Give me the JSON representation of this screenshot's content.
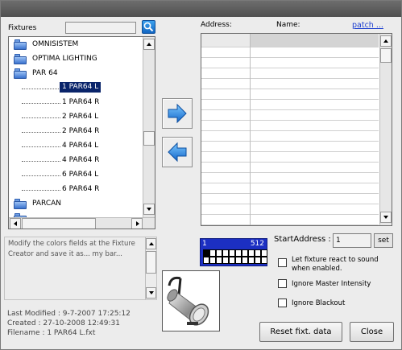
{
  "fixtures": {
    "label": "Fixtures",
    "search_value": "",
    "tree": [
      {
        "type": "folder",
        "label": "OMNISISTEM"
      },
      {
        "type": "folder",
        "label": "OPTIMA LIGHTING"
      },
      {
        "type": "folder",
        "label": "PAR 64"
      },
      {
        "type": "child",
        "label": "1 PAR64 L",
        "selected": true
      },
      {
        "type": "child",
        "label": "1 PAR64 R"
      },
      {
        "type": "child",
        "label": "2 PAR64 L"
      },
      {
        "type": "child",
        "label": "2 PAR64 R"
      },
      {
        "type": "child",
        "label": "4 PAR64 L"
      },
      {
        "type": "child",
        "label": "4 PAR64 R"
      },
      {
        "type": "child",
        "label": "6 PAR64 L"
      },
      {
        "type": "child",
        "label": "6 PAR64 R"
      },
      {
        "type": "folder",
        "label": "PARCAN"
      },
      {
        "type": "folder",
        "label": ""
      }
    ]
  },
  "patch": {
    "address_label": "Address:",
    "name_label": "Name:",
    "patch_link": "patch ..."
  },
  "notes": {
    "text": "Modify the colors fields at the Fixture Creator and save it as... my bar..."
  },
  "file_info": {
    "last_modified": "Last Modified : 9-7-2007 17:25:12",
    "created": "Created : 27-10-2008 12:49:31",
    "filename": "Filename : 1 PAR64 L.fxt"
  },
  "dmx": {
    "start": "1",
    "end": "512",
    "filled_channels": 1
  },
  "start_address": {
    "label": "StartAddress :",
    "value": "1",
    "set_label": "set"
  },
  "options": [
    {
      "label": "Let fixture react to sound when enabled.",
      "checked": false
    },
    {
      "label": "Ignore Master Intensity",
      "checked": false
    },
    {
      "label": "Ignore Blackout",
      "checked": false
    }
  ],
  "buttons": {
    "reset": "Reset fixt. data",
    "close": "Close"
  },
  "colors": {
    "selection": "#0a246a",
    "dmx_blue": "#1c2fc2",
    "arrow_blue": "#1b7fe0"
  }
}
